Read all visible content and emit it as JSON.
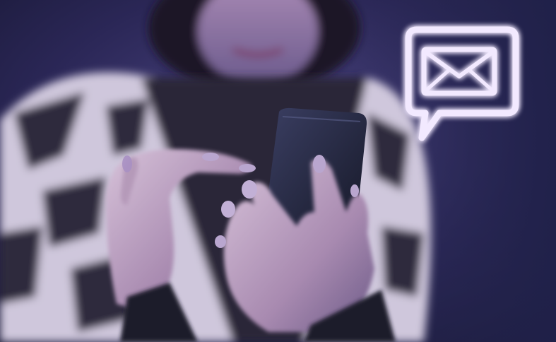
{
  "photo": {
    "subject": "person-using-smartphone",
    "palette": {
      "background_dark": "#1c1b3d",
      "background_mid": "#3a3470",
      "sweater_light": "#d9d2e6",
      "sweater_dark": "#2a2738",
      "skin": "#b49ab6",
      "nail": "#b59fc4",
      "phone": "#1f2236",
      "glow": "#f1e8ff"
    }
  },
  "overlay": {
    "icon": "envelope-in-speech-bubble-icon",
    "glow_color": "#e8d9ff"
  }
}
